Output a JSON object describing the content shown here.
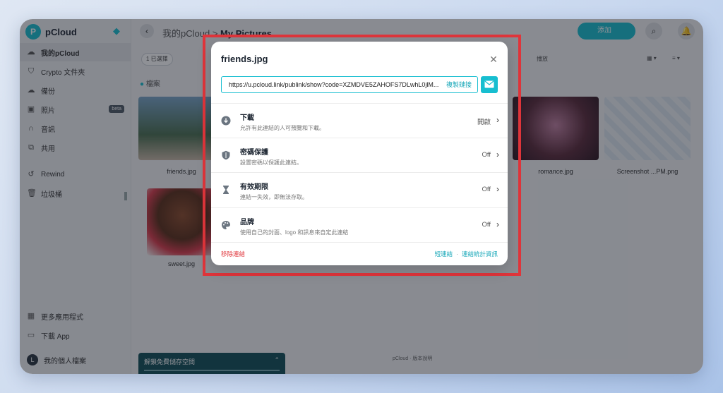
{
  "colors": {
    "accent": "#17bed0",
    "highlight": "#e0353b",
    "danger": "#e0353b"
  },
  "app": {
    "name": "pCloud"
  },
  "sidebar": {
    "items": [
      {
        "label": "我的pCloud",
        "icon": "cloud-icon"
      },
      {
        "label": "Crypto 文件夾",
        "icon": "shield-icon"
      },
      {
        "label": "備份",
        "icon": "backup-icon"
      },
      {
        "label": "照片",
        "icon": "photo-icon",
        "badge": "beta"
      },
      {
        "label": "音訊",
        "icon": "headphones-icon"
      },
      {
        "label": "共用",
        "icon": "shared-icon"
      },
      {
        "label": "Rewind",
        "icon": "rewind-icon"
      },
      {
        "label": "垃圾桶",
        "icon": "trash-icon"
      }
    ],
    "bottom_items": [
      {
        "label": "更多應用程式",
        "icon": "apps-icon"
      },
      {
        "label": "下載 App",
        "icon": "download-app-icon"
      },
      {
        "label": "我的個人檔案",
        "avatar": "L"
      }
    ]
  },
  "header": {
    "breadcrumb_root": "我的pCloud",
    "breadcrumb_sep": ">",
    "breadcrumb_current": "My Pictures",
    "add_label": "添加"
  },
  "toolbar": {
    "selected_chip": "1 已選擇",
    "share_label": "播放"
  },
  "files": {
    "section_label": "檔案",
    "items": [
      {
        "name": "friends.jpg"
      },
      {
        "name": "romance.jpg"
      },
      {
        "name": "Screenshot ...PM.png"
      },
      {
        "name": "sweet.jpg"
      }
    ]
  },
  "footer": {
    "brand": "pCloud · 版本說明",
    "storage_banner": "解鎖免費儲存空間"
  },
  "modal": {
    "title": "friends.jpg",
    "link": "https://u.pcloud.link/publink/show?code=XZMDVE5ZAHOFS7DLwhL0jlM...",
    "copy_label": "複製鏈接",
    "options": [
      {
        "title": "下載",
        "desc": "允許有此連結的人可預覽和下載。",
        "value": "開啟",
        "icon": "download-icon"
      },
      {
        "title": "密碼保護",
        "desc": "設置密碼以保護此連結。",
        "value": "Off",
        "icon": "shield-lock-icon"
      },
      {
        "title": "有效期限",
        "desc": "連結一失效，即無法存取。",
        "value": "Off",
        "icon": "hourglass-icon"
      },
      {
        "title": "品牌",
        "desc": "使用自己的封面、logo 和訊息來自定此連結",
        "value": "Off",
        "icon": "palette-icon"
      }
    ],
    "remove_label": "移除連結",
    "short_link_label": "短連結",
    "separator": "·",
    "stats_label": "連結統計資訊"
  }
}
